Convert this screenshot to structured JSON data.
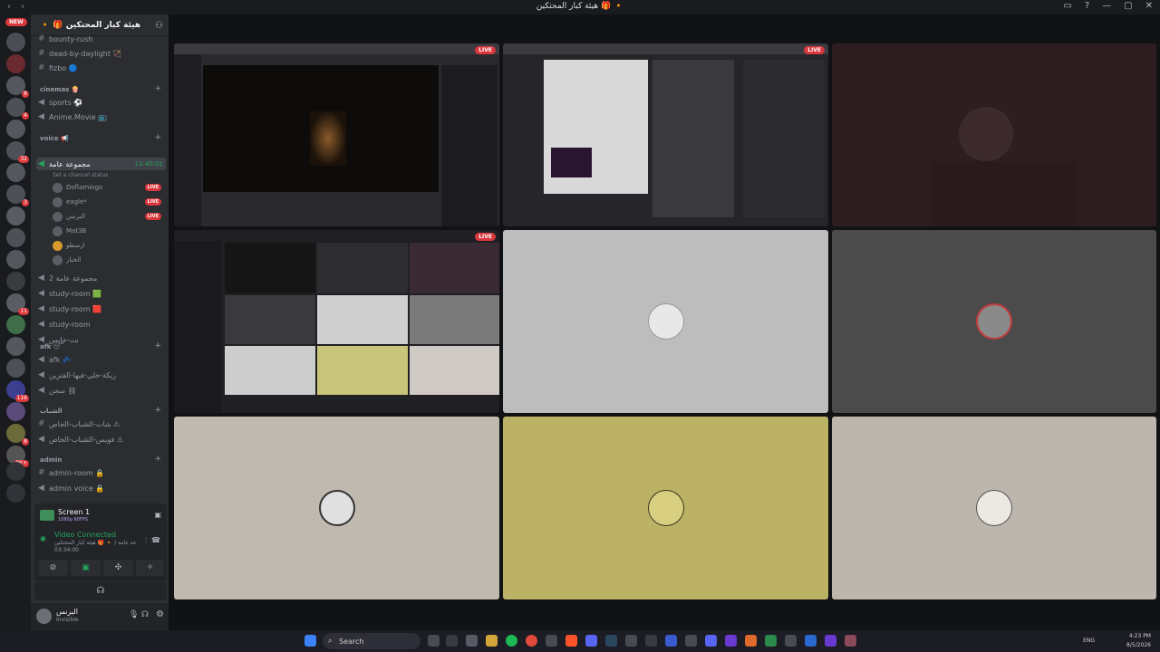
{
  "titlebar": {
    "nav": "‹ ›",
    "title": "هيئة كبار المحتكين 🎁 🔸"
  },
  "rail": {
    "new_badge": "NEW",
    "badges": [
      "8",
      "4",
      "32",
      "3",
      "11",
      "116",
      "8",
      "9K+"
    ]
  },
  "guild": {
    "name": "🔸 🎁 هيئة كبار المحتكين"
  },
  "channels": {
    "top": [
      {
        "name": "bounty-rush"
      },
      {
        "name": "dead-by-daylight 🏹"
      },
      {
        "name": "fizbo 🔵"
      }
    ],
    "cinemas": {
      "label": "cinemas 🍿",
      "items": [
        {
          "name": "sports ⚽"
        },
        {
          "name": "Anime.Movie 📺"
        }
      ]
    },
    "voice": {
      "label": "voice 📢",
      "active": {
        "name": "مجموعة عامة",
        "time": "11:40:01",
        "status": "Set a channel status"
      },
      "users": [
        {
          "name": "Doflamingo",
          "live": "LIVE"
        },
        {
          "name": "eagle*",
          "live": "LIVE"
        },
        {
          "name": "البرنس",
          "live": "LIVE"
        },
        {
          "name": "Mat3B",
          "live": ""
        },
        {
          "name": "ارسطو",
          "live": ""
        },
        {
          "name": "الخنار",
          "live": ""
        }
      ],
      "more": [
        {
          "name": "مجموعة عامة 2"
        },
        {
          "name": "study-room 🟩"
        },
        {
          "name": "study-room 🟥"
        },
        {
          "name": "study-room"
        },
        {
          "name": "نت-خايس"
        }
      ]
    },
    "afk": {
      "label": "afk 😴",
      "items": [
        {
          "name": "afk 💤"
        },
        {
          "name": "زيكة-خلي-فيها-القترين"
        },
        {
          "name": "سجن ⛓"
        }
      ]
    },
    "youth": {
      "label": "الشباب",
      "items": [
        {
          "name": "شات-الشباب-الخاص ⚠"
        },
        {
          "name": "فويس-الشباب-الخاص ⚠"
        }
      ]
    },
    "admin": {
      "label": "admin",
      "items": [
        {
          "name": "admin-room 🔒"
        },
        {
          "name": "admin voice 🔒"
        }
      ]
    }
  },
  "voice_panel": {
    "screen_title": "Screen 1",
    "screen_sub": "1080p 60FPS",
    "connected": "Video Connected",
    "channel": "مجموعة عامة / 🔸 🎁 هيئة كبار المحتكين",
    "timer": "03:34:00"
  },
  "user_panel": {
    "name": "البرنس",
    "status": "Invisible"
  },
  "stage": {
    "live_label": "LIVE",
    "tiles": [
      {
        "bg": "#2a2a2e",
        "live": true,
        "name": "screen-share-game"
      },
      {
        "bg": "#26262a",
        "live": true,
        "name": "screen-share-browser"
      },
      {
        "bg": "#2d1e22",
        "live": false,
        "name": "camera-feed"
      },
      {
        "bg": "#202024",
        "live": true,
        "name": "screen-share-grid"
      },
      {
        "bg": "#bdbdbd",
        "live": false,
        "name": "participant-tile"
      },
      {
        "bg": "#4b4b4b",
        "live": false,
        "name": "participant-tile"
      },
      {
        "bg": "#c0b9b0",
        "live": false,
        "name": "participant-tile"
      },
      {
        "bg": "#bcb266",
        "live": false,
        "name": "participant-tile"
      },
      {
        "bg": "#bdb6ad",
        "live": false,
        "name": "participant-tile"
      }
    ]
  },
  "taskbar": {
    "search": "Search",
    "lang": "ENG",
    "time": "4:23 PM",
    "date": "8/5/2026"
  }
}
